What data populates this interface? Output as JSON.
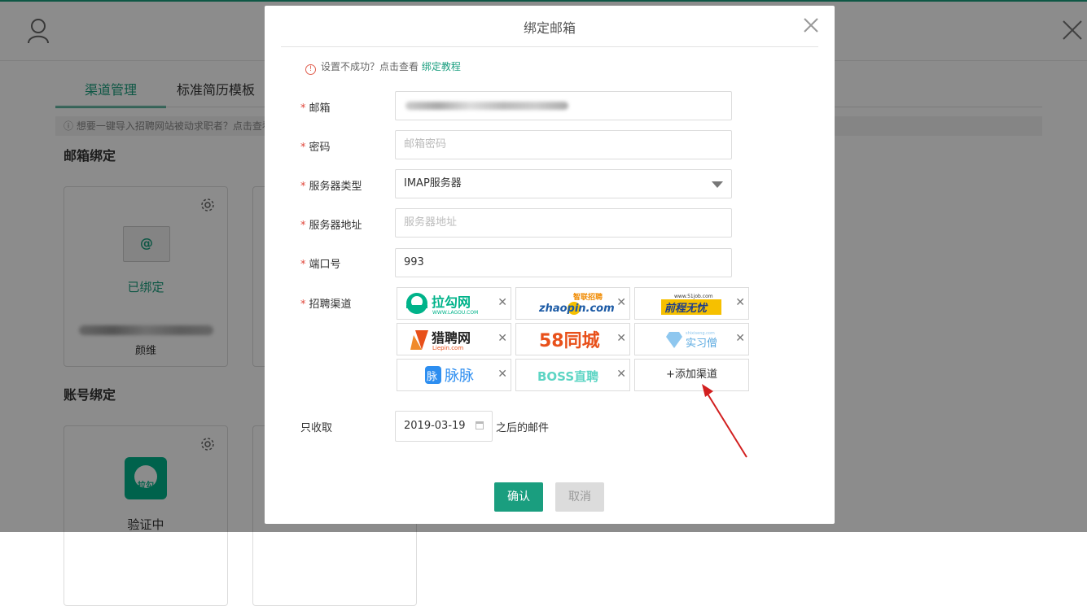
{
  "background": {
    "tabs": [
      "渠道管理",
      "标准简历模板"
    ],
    "tip_text": "想要一键导入招聘网站被动求职者？点击查看",
    "email_section_title": "邮箱绑定",
    "email_card": {
      "status": "已绑定",
      "user": "颜维"
    },
    "account_section_title": "账号绑定",
    "account_card": {
      "status": "验证中"
    }
  },
  "modal": {
    "title": "绑定邮箱",
    "notice": {
      "text": "设置不成功？点击查看",
      "link": "绑定教程"
    },
    "fields": {
      "email": {
        "label": "邮箱"
      },
      "password": {
        "label": "密码",
        "placeholder": "邮箱密码"
      },
      "server_type": {
        "label": "服务器类型",
        "value": "IMAP服务器"
      },
      "server_address": {
        "label": "服务器地址",
        "placeholder": "服务器地址"
      },
      "port": {
        "label": "端口号",
        "value": "993"
      },
      "channels": {
        "label": "招聘渠道"
      },
      "receive_only": {
        "label": "只收取",
        "date": "2019-03-19",
        "suffix": "之后的邮件"
      }
    },
    "channel_list": [
      {
        "name": "拉勾网",
        "sub": "WWW.LAGOU.COM"
      },
      {
        "name": "zhaopin.com",
        "sub": "智联招聘"
      },
      {
        "name": "前程无忧",
        "sub": "www.51job.com"
      },
      {
        "name": "猎聘网",
        "sub": "Liepin.com"
      },
      {
        "name": "58同城"
      },
      {
        "name": "实习僧",
        "sub": "shixiseng.com"
      },
      {
        "name": "脉脉"
      },
      {
        "name": "BOSS直聘"
      }
    ],
    "add_channel": "+添加渠道",
    "confirm": "确认",
    "cancel": "取消"
  },
  "colors": {
    "accent": "#1a9e7f",
    "required": "#e0463a",
    "arrow": "#d21f1f"
  }
}
